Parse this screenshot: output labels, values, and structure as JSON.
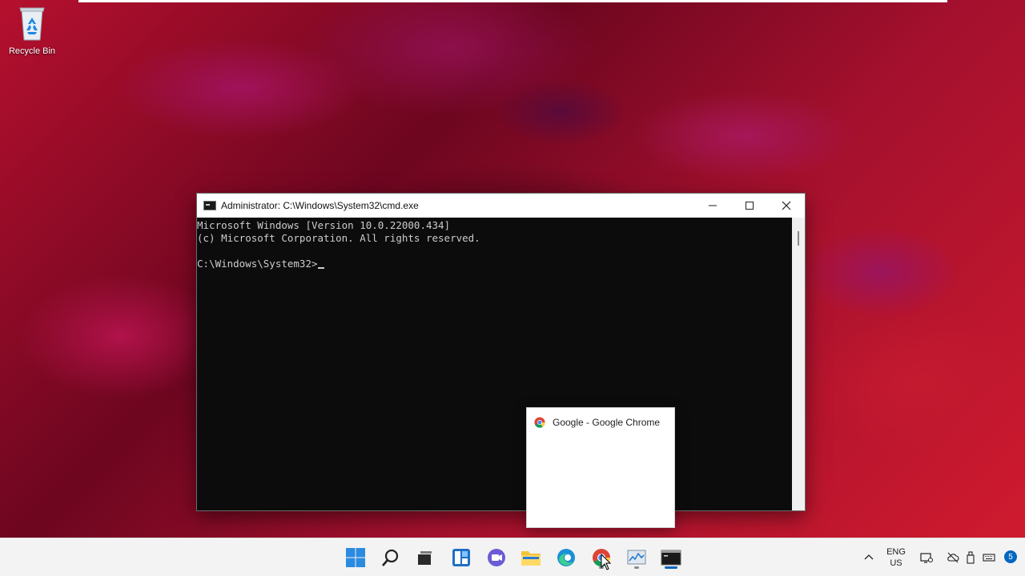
{
  "desktop": {
    "recycle_bin_label": "Recycle Bin"
  },
  "cmd": {
    "title": "Administrator: C:\\Windows\\System32\\cmd.exe",
    "lines": [
      "Microsoft Windows [Version 10.0.22000.434]",
      "(c) Microsoft Corporation. All rights reserved.",
      "",
      "C:\\Windows\\System32>"
    ]
  },
  "preview": {
    "title": "Google - Google Chrome"
  },
  "taskbar": {
    "icons": [
      "start-icon",
      "search-icon",
      "task-view-icon",
      "widgets-icon",
      "chat-icon",
      "file-explorer-icon",
      "edge-icon",
      "chrome-icon",
      "task-manager-icon",
      "cmd-icon"
    ],
    "lang_top": "ENG",
    "lang_bottom": "US",
    "notification_count": "5"
  },
  "colors": {
    "accent": "#0067c0",
    "console_bg": "#0c0c0c",
    "console_text": "#cccccc"
  }
}
